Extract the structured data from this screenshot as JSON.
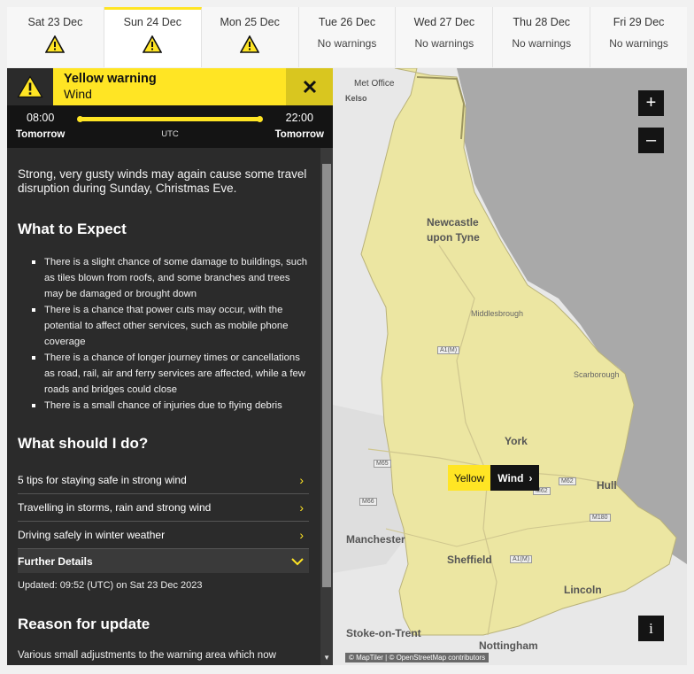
{
  "tabs": [
    {
      "date": "Sat 23 Dec",
      "warning": true,
      "text": ""
    },
    {
      "date": "Sun 24 Dec",
      "warning": true,
      "text": "",
      "active": true
    },
    {
      "date": "Mon 25 Dec",
      "warning": true,
      "text": ""
    },
    {
      "date": "Tue 26 Dec",
      "warning": false,
      "text": "No warnings"
    },
    {
      "date": "Wed 27 Dec",
      "warning": false,
      "text": "No warnings"
    },
    {
      "date": "Thu 28 Dec",
      "warning": false,
      "text": "No warnings"
    },
    {
      "date": "Fri 29 Dec",
      "warning": false,
      "text": "No warnings"
    }
  ],
  "warning": {
    "level": "Yellow warning",
    "type": "Wind",
    "start_time": "08:00",
    "start_day": "Tomorrow",
    "end_time": "22:00",
    "end_day": "Tomorrow",
    "timezone": "UTC",
    "close_icon": "close-icon",
    "accent_color": "#ffe524"
  },
  "content": {
    "intro": "Strong, very gusty winds may again cause some travel disruption during Sunday, Christmas Eve.",
    "expect_heading": "What to Expect",
    "expect_items": [
      "There is a slight chance of some damage to buildings, such as tiles blown from roofs, and some branches and trees may be damaged or brought down",
      "There is a chance that power cuts may occur, with the potential to affect other services, such as mobile phone coverage",
      "There is a chance of longer journey times or cancellations as road, rail, air and ferry services are affected, while a few roads and bridges could close",
      "There is a small chance of injuries due to flying debris"
    ],
    "todo_heading": "What should I do?",
    "links": [
      "5 tips for staying safe in strong wind",
      "Travelling in storms, rain and strong wind",
      "Driving safely in winter weather"
    ],
    "further_details": "Further Details",
    "updated": "Updated: 09:52 (UTC) on Sat 23 Dec 2023",
    "reason_heading": "Reason for update",
    "reason": "Various small adjustments to the warning area which now excludes Leicestershire."
  },
  "map": {
    "logo": "Met Office",
    "zoom_in": "+",
    "zoom_out": "–",
    "info": "i",
    "attribution": "© MapTiler | © OpenStreetMap contributors",
    "marker_level": "Yellow",
    "marker_type": "Wind",
    "places": {
      "kelso": "Kelso",
      "newcastle_1": "Newcastle",
      "newcastle_2": "upon Tyne",
      "middlesbrough": "Middlesbrough",
      "scarborough": "Scarborough",
      "york": "York",
      "hull": "Hull",
      "manchester": "Manchester",
      "sheffield": "Sheffield",
      "lincoln": "Lincoln",
      "stoke": "Stoke-on-Trent",
      "nottingham": "Nottingham"
    },
    "roads": {
      "a1m_north": "A1(M)",
      "a1m_south": "A1(M)",
      "m65": "M65",
      "m66": "M66",
      "m62_a": "M62",
      "m62_b": "M62",
      "m180": "M180"
    }
  }
}
